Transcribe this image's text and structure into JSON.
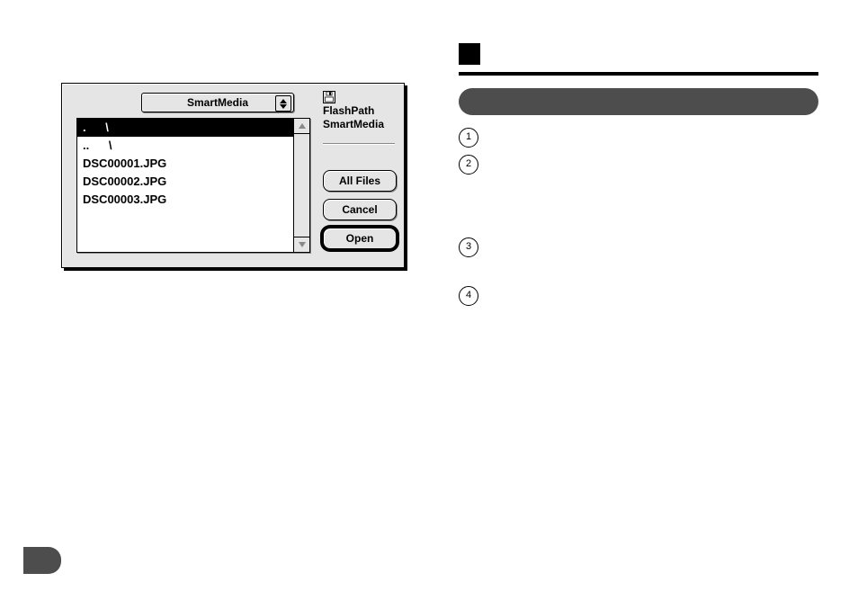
{
  "right": {
    "steps": [
      "1",
      "2",
      "3",
      "4"
    ]
  },
  "dialog": {
    "popup_label": "SmartMedia",
    "volume_line1": "FlashPath",
    "volume_line2": "SmartMedia",
    "files": [
      ".      \\",
      "..      \\",
      "DSC00001.JPG",
      "DSC00002.JPG",
      "DSC00003.JPG"
    ],
    "selected_index": 0,
    "buttons": {
      "all_files": "All Files",
      "cancel": "Cancel",
      "open": "Open"
    }
  }
}
